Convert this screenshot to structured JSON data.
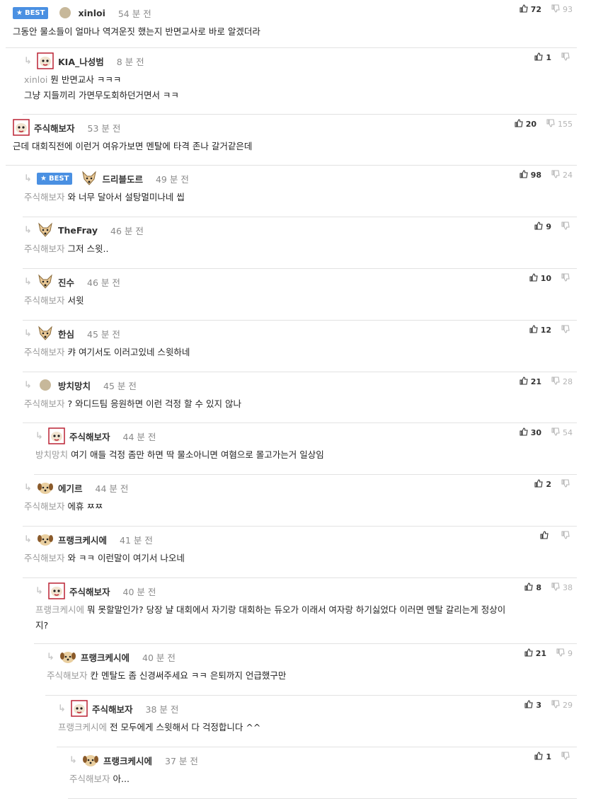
{
  "best_label": "BEST",
  "comments": [
    {
      "nick": "xinloi",
      "time": "54 분 전",
      "best": true,
      "reply": false,
      "avatar": "circle",
      "mention": "",
      "text": "그동안 물소들이 얼마나 역겨운짓 했는지 반면교사로 바로 알겠더라",
      "up": "72",
      "down": "93"
    },
    {
      "nick": "KIA_나성범",
      "time": "8 분 전",
      "best": false,
      "reply": true,
      "avatar": "red",
      "mention": "xinloi",
      "text": "뭔 반면교사 ㅋㅋㅋ",
      "text2": "그냥 지들끼리 가면무도회하던거면서 ㅋㅋ",
      "up": "1",
      "down": ""
    },
    {
      "nick": "주식해보자",
      "time": "53 분 전",
      "best": false,
      "reply": false,
      "avatar": "red",
      "mention": "",
      "text": "근데 대회직전에 이런거 여유가보면 멘탈에 타격 존나 갈거같은데",
      "up": "20",
      "down": "155"
    },
    {
      "nick": "드리블도르",
      "time": "49 분 전",
      "best": true,
      "reply": true,
      "avatar": "fox",
      "mention": "주식해보자",
      "text": "와 너무 달아서 설탕멀미나네 씹",
      "up": "98",
      "down": "24"
    },
    {
      "nick": "TheFray",
      "time": "46 분 전",
      "best": false,
      "reply": true,
      "avatar": "fox",
      "mention": "주식해보자",
      "text": "그저 스윗..",
      "up": "9",
      "down": ""
    },
    {
      "nick": "진수",
      "time": "46 분 전",
      "best": false,
      "reply": true,
      "avatar": "fox",
      "mention": "주식해보자",
      "text": "서윗",
      "up": "10",
      "down": ""
    },
    {
      "nick": "한심",
      "time": "45 분 전",
      "best": false,
      "reply": true,
      "avatar": "fox",
      "mention": "주식해보자",
      "text": "캬 여기서도 이러고있네 스윗하네",
      "up": "12",
      "down": ""
    },
    {
      "nick": "방치망치",
      "time": "45 분 전",
      "best": false,
      "reply": true,
      "avatar": "circle",
      "mention": "주식해보자",
      "text": "? 와디드팀 응원하면 이런 걱정 할 수 있지 않나",
      "up": "21",
      "down": "28"
    },
    {
      "nick": "주식해보자",
      "time": "44 분 전",
      "best": false,
      "reply": true,
      "avatar": "red",
      "mention": "방치망치",
      "text": "여기 애들 걱정 좀만 하면 딱 물소아니면 여혐으로 몰고가는거 일상임",
      "up": "30",
      "down": "54"
    },
    {
      "nick": "에기르",
      "time": "44 분 전",
      "best": false,
      "reply": true,
      "avatar": "puppy",
      "mention": "주식해보자",
      "text": "에휴 ㅉㅉ",
      "up": "2",
      "down": ""
    },
    {
      "nick": "프랭크케시에",
      "time": "41 분 전",
      "best": false,
      "reply": true,
      "avatar": "puppy",
      "mention": "주식해보자",
      "text": "와 ㅋㅋ 이런말이 여기서 나오네",
      "up": "",
      "down": ""
    },
    {
      "nick": "주식해보자",
      "time": "40 분 전",
      "best": false,
      "reply": true,
      "avatar": "red",
      "mention": "프랭크케시에",
      "text": "뭐 못할말인가? 당장 냘 대회에서 자기랑 대회하는 듀오가 이래서 여자랑 하기싫었다 이러면 멘탈 갈리는게 정상이",
      "text2": "지?",
      "up": "8",
      "down": "38"
    },
    {
      "nick": "프랭크케시에",
      "time": "40 분 전",
      "best": false,
      "reply": true,
      "avatar": "puppy",
      "mention": "주식해보자",
      "text": "칸 멘탈도 좀 신경써주세요 ㅋㅋ 은퇴까지 언급했구만",
      "up": "21",
      "down": "9"
    },
    {
      "nick": "주식해보자",
      "time": "38 분 전",
      "best": false,
      "reply": true,
      "avatar": "red",
      "mention": "프랭크케시에",
      "text": "전 모두에게 스윗해서 다 걱정합니다 ^^",
      "up": "3",
      "down": "29"
    },
    {
      "nick": "프랭크케시에",
      "time": "37 분 전",
      "best": false,
      "reply": true,
      "avatar": "puppy",
      "mention": "주식해보자",
      "text": "아...",
      "up": "1",
      "down": ""
    }
  ]
}
